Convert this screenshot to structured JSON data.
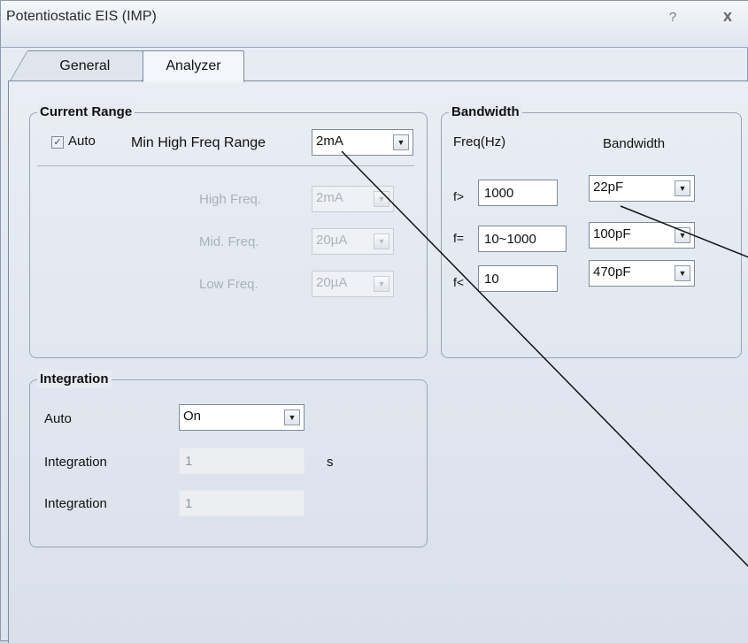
{
  "window": {
    "title": "Potentiostatic EIS (IMP)",
    "help_label": "?",
    "close_label": "x"
  },
  "tabs": [
    {
      "label": "General"
    },
    {
      "label": "Analyzer"
    }
  ],
  "current_range": {
    "title": "Current Range",
    "auto_label": "Auto",
    "auto_checked": true,
    "min_high_freq_label": "Min High Freq Range",
    "min_high_freq_value": "2mA",
    "high_freq_label": "High Freq.",
    "high_freq_value": "2mA",
    "mid_freq_label": "Mid. Freq.",
    "mid_freq_value": "20µA",
    "low_freq_label": "Low Freq.",
    "low_freq_value": "20µA"
  },
  "bandwidth": {
    "title": "Bandwidth",
    "freq_header": "Freq(Hz)",
    "bw_header": "Bandwidth",
    "rows": [
      {
        "op": "f>",
        "freq": "1000",
        "bw": "22pF"
      },
      {
        "op": "f=",
        "freq": "10~1000",
        "bw": "100pF"
      },
      {
        "op": "f<",
        "freq": "10",
        "bw": "470pF"
      }
    ]
  },
  "integration": {
    "title": "Integration",
    "auto_label": "Auto",
    "auto_value": "On",
    "integration_label_1": "Integration",
    "integration_value_1": "1",
    "unit": "s",
    "integration_label_2": "Integration",
    "integration_value_2": "1"
  },
  "icons": {
    "checkbox": "checkmark-icon",
    "dropdown": "triangle-down-icon"
  }
}
